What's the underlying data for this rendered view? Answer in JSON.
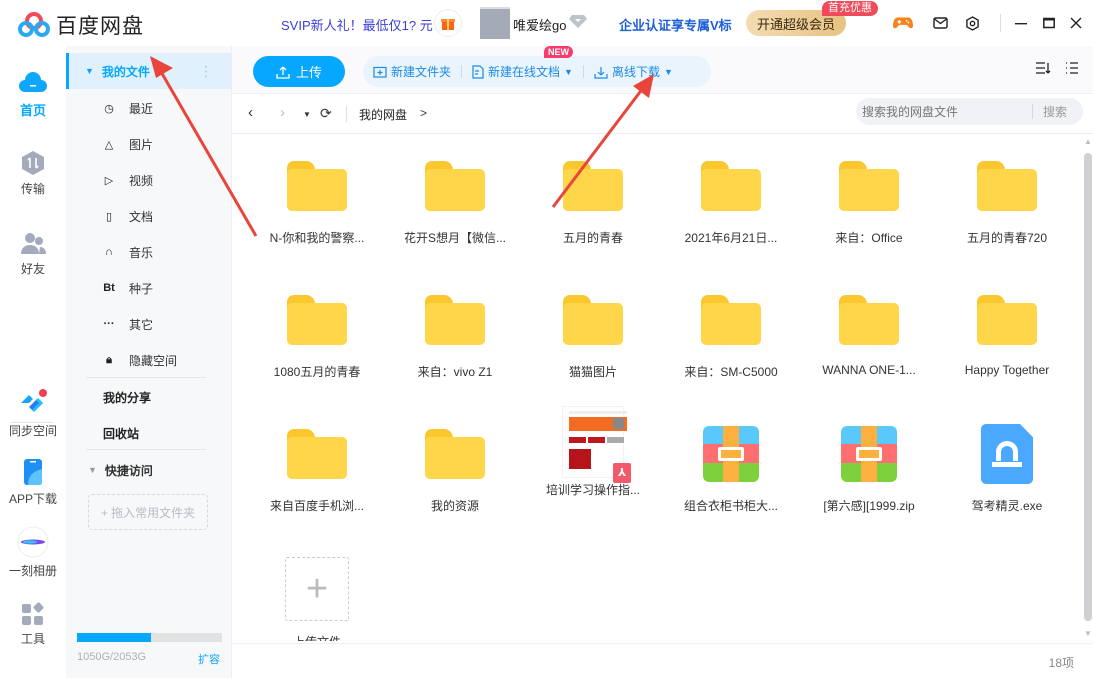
{
  "app": {
    "title": "百度网盘"
  },
  "header": {
    "promo": "SVIP新人礼！最低仅1? 元",
    "username": "唯爱绘go",
    "enterprise": "企业认证享专属V标",
    "vip_button": "开通超级会员",
    "vip_badge": "首充优惠"
  },
  "rail": [
    {
      "label": "首页",
      "icon": "cloud-icon",
      "active": true
    },
    {
      "label": "传输",
      "icon": "transfer-icon"
    },
    {
      "label": "好友",
      "icon": "friends-icon"
    },
    {
      "label": "同步空间",
      "icon": "sync-icon"
    },
    {
      "label": "APP下载",
      "icon": "phone-icon"
    },
    {
      "label": "一刻相册",
      "icon": "album-icon"
    },
    {
      "label": "工具",
      "icon": "tools-icon"
    }
  ],
  "nav": {
    "my_files": "我的文件",
    "items": [
      {
        "label": "最近",
        "icon": "clock-icon"
      },
      {
        "label": "图片",
        "icon": "image-icon"
      },
      {
        "label": "视频",
        "icon": "play-icon"
      },
      {
        "label": "文档",
        "icon": "document-icon"
      },
      {
        "label": "音乐",
        "icon": "headphones-icon"
      },
      {
        "label": "种子",
        "icon": "bt-icon"
      },
      {
        "label": "其它",
        "icon": "more-icon"
      },
      {
        "label": "隐藏空间",
        "icon": "lock-icon"
      }
    ],
    "my_share": "我的分享",
    "recycle": "回收站",
    "quick_access": "快捷访问",
    "quick_placeholder": "+ 拖入常用文件夹",
    "storage_text": "1050G/2053G",
    "storage_used_fraction": 0.511,
    "expand": "扩容"
  },
  "toolbar": {
    "upload": "上传",
    "new_folder": "新建文件夹",
    "new_doc": "新建在线文档",
    "new_badge": "NEW",
    "offline_download": "离线下载"
  },
  "breadcrumb": {
    "root": "我的网盘",
    "sep": ">"
  },
  "search": {
    "placeholder": "搜索我的网盘文件",
    "button": "搜索"
  },
  "files": [
    {
      "name": "N-你和我的警察...",
      "type": "folder"
    },
    {
      "name": "花开S想月【微信...",
      "type": "folder"
    },
    {
      "name": "五月的青春",
      "type": "folder"
    },
    {
      "name": "2021年6月21日...",
      "type": "folder"
    },
    {
      "name": "来自：Office",
      "type": "folder"
    },
    {
      "name": "五月的青春720",
      "type": "folder"
    },
    {
      "name": "1080五月的青春",
      "type": "folder"
    },
    {
      "name": "来自：vivo Z1",
      "type": "folder"
    },
    {
      "name": "猫猫图片",
      "type": "folder"
    },
    {
      "name": "来自：SM-C5000",
      "type": "folder"
    },
    {
      "name": "WANNA ONE-1...",
      "type": "folder"
    },
    {
      "name": "Happy Together",
      "type": "folder"
    },
    {
      "name": "来自百度手机浏...",
      "type": "folder"
    },
    {
      "name": "我的资源",
      "type": "folder"
    },
    {
      "name": "培训学习操作指...",
      "type": "pdf"
    },
    {
      "name": "组合衣柜书柜大...",
      "type": "zip"
    },
    {
      "name": "[第六感][1999.zip",
      "type": "zip"
    },
    {
      "name": "驾考精灵.exe",
      "type": "exe"
    }
  ],
  "add_tile": "上传文件",
  "footer": {
    "count": "18项"
  },
  "colors": {
    "accent": "#06a7ff",
    "folder": "#ffd54a",
    "vip_badge": "#ef4b5a",
    "promo": "#3a3fd8"
  }
}
